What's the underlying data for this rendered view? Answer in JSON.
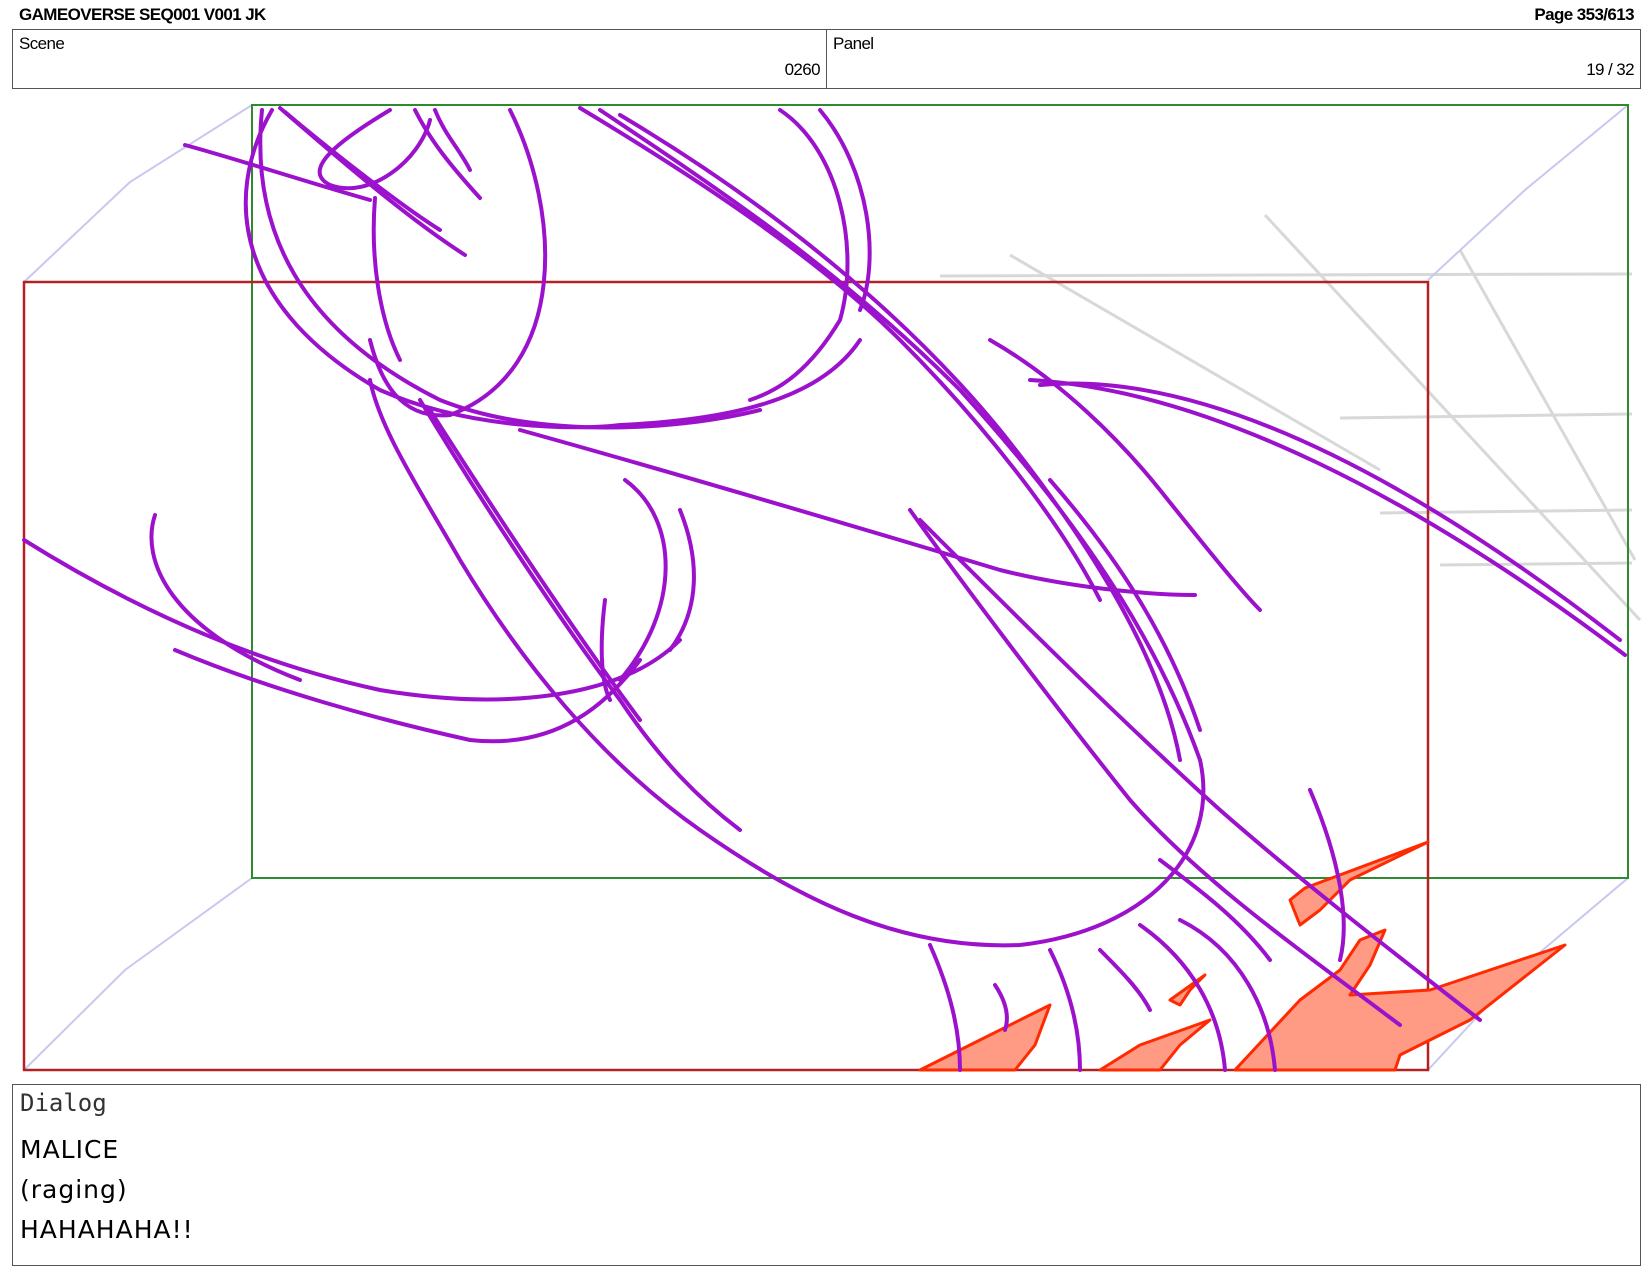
{
  "header": {
    "title": "GAMEOVERSE SEQ001 V001 JK",
    "page": "Page 353/613"
  },
  "info": {
    "scene_label": "Scene",
    "scene_value": "0260",
    "panel_label": "Panel",
    "panel_value": "19 / 32"
  },
  "frame_colors": {
    "safe_frame": "#2e8b2e",
    "camera_frame": "#b22222",
    "guide": "#c8c8f0"
  },
  "sketch_colors": {
    "line": "#9c12cc",
    "fire_outline": "#ff2a00",
    "fire_fill": "#ff9a85",
    "bg_lines": "#d8d8d8"
  },
  "dialog": {
    "label": "Dialog",
    "lines": [
      "MALICE",
      "(raging)",
      "HAHAHAHA!!"
    ]
  }
}
